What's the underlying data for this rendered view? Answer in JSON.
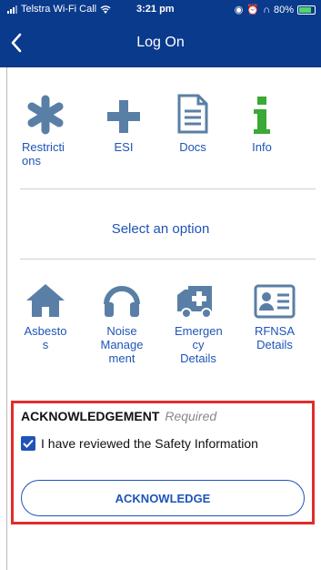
{
  "status_bar": {
    "carrier": "Telstra Wi-Fi Call",
    "time": "3:21 pm",
    "battery": "80%"
  },
  "nav": {
    "title": "Log On"
  },
  "top_options": [
    {
      "label": "Restricti\nons",
      "icon": "asterisk-icon"
    },
    {
      "label": "ESI",
      "icon": "plus-icon"
    },
    {
      "label": "Docs",
      "icon": "document-icon"
    },
    {
      "label": "Info",
      "icon": "info-icon"
    }
  ],
  "select_option_text": "Select an option",
  "bottom_options": [
    {
      "label": "Asbesto\ns",
      "icon": "house-icon"
    },
    {
      "label": "Noise\nManage\nment",
      "icon": "headphones-icon"
    },
    {
      "label": "Emergen\ncy\nDetails",
      "icon": "ambulance-icon"
    },
    {
      "label": "RFNSA\nDetails",
      "icon": "id-card-icon"
    }
  ],
  "acknowledgement": {
    "title": "ACKNOWLEDGEMENT",
    "required": "Required",
    "checkbox_label": "I have reviewed the Safety Information",
    "checked": true,
    "button_label": "ACKNOWLEDGE"
  },
  "colors": {
    "header": "#0a3a8c",
    "accent": "#1e54b8",
    "icon": "#5a7fa6",
    "info": "#3aa935",
    "highlight": "#e12c2c"
  }
}
